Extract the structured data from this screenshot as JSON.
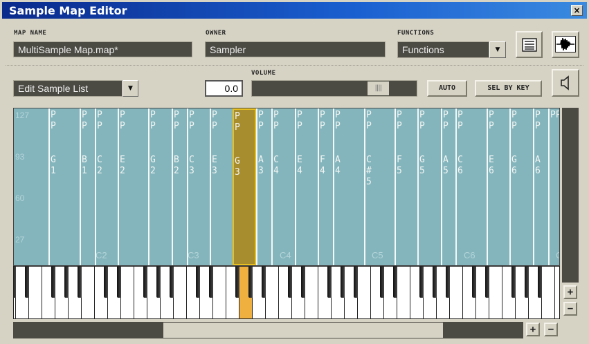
{
  "window": {
    "title": "Sample Map Editor",
    "close_label": "×"
  },
  "map_name": {
    "label": "MAP NAME",
    "value": "MultiSample Map.map*"
  },
  "owner": {
    "label": "OWNER",
    "value": "Sampler"
  },
  "functions": {
    "label": "FUNCTIONS",
    "value": "Functions"
  },
  "edit_mode": {
    "value": "Edit Sample List"
  },
  "volume": {
    "label": "VOLUME",
    "value": "0.0",
    "slider_fraction": 0.82
  },
  "buttons": {
    "auto": "AUTO",
    "sel_by_key": "SEL BY KEY",
    "plus": "+",
    "minus": "−",
    "arrow": "▼"
  },
  "velocity_labels": [
    "127",
    "93",
    "60",
    "27"
  ],
  "octave_labels": [
    "C2",
    "C3",
    "C4",
    "C5",
    "C6",
    "C"
  ],
  "zones": [
    {
      "top": "",
      "note": ""
    },
    {
      "top": "PP",
      "note": "G1"
    },
    {
      "top": "PP",
      "note": "B1"
    },
    {
      "top": "PP",
      "note": "C2"
    },
    {
      "top": "PP",
      "note": "E2"
    },
    {
      "top": "PP",
      "note": "G2"
    },
    {
      "top": "PP",
      "note": "B2"
    },
    {
      "top": "PP",
      "note": "C3"
    },
    {
      "top": "PP",
      "note": "E3"
    },
    {
      "top": "PP",
      "note": "G3",
      "selected": true
    },
    {
      "top": "PP",
      "note": "A3"
    },
    {
      "top": "PP",
      "note": "C4"
    },
    {
      "top": "PP",
      "note": "E4"
    },
    {
      "top": "PP",
      "note": "F4"
    },
    {
      "top": "PP",
      "note": "A4"
    },
    {
      "top": "PP",
      "note": "C#5"
    },
    {
      "top": "PP",
      "note": "F5"
    },
    {
      "top": "PP",
      "note": "G5"
    },
    {
      "top": "PP",
      "note": "A5"
    },
    {
      "top": "PP",
      "note": "C6"
    },
    {
      "top": "PP",
      "note": "E6"
    },
    {
      "top": "PP",
      "note": "G6"
    },
    {
      "top": "PP",
      "note": "A6"
    },
    {
      "top": "PP",
      "note": ""
    }
  ],
  "keyboard": {
    "highlighted_key": "G3",
    "highlight_color": "#f0b040"
  },
  "colors": {
    "zone": "#84b5bd",
    "selected_zone": "#a88d2e",
    "title_bar": "#0a2a8c"
  }
}
